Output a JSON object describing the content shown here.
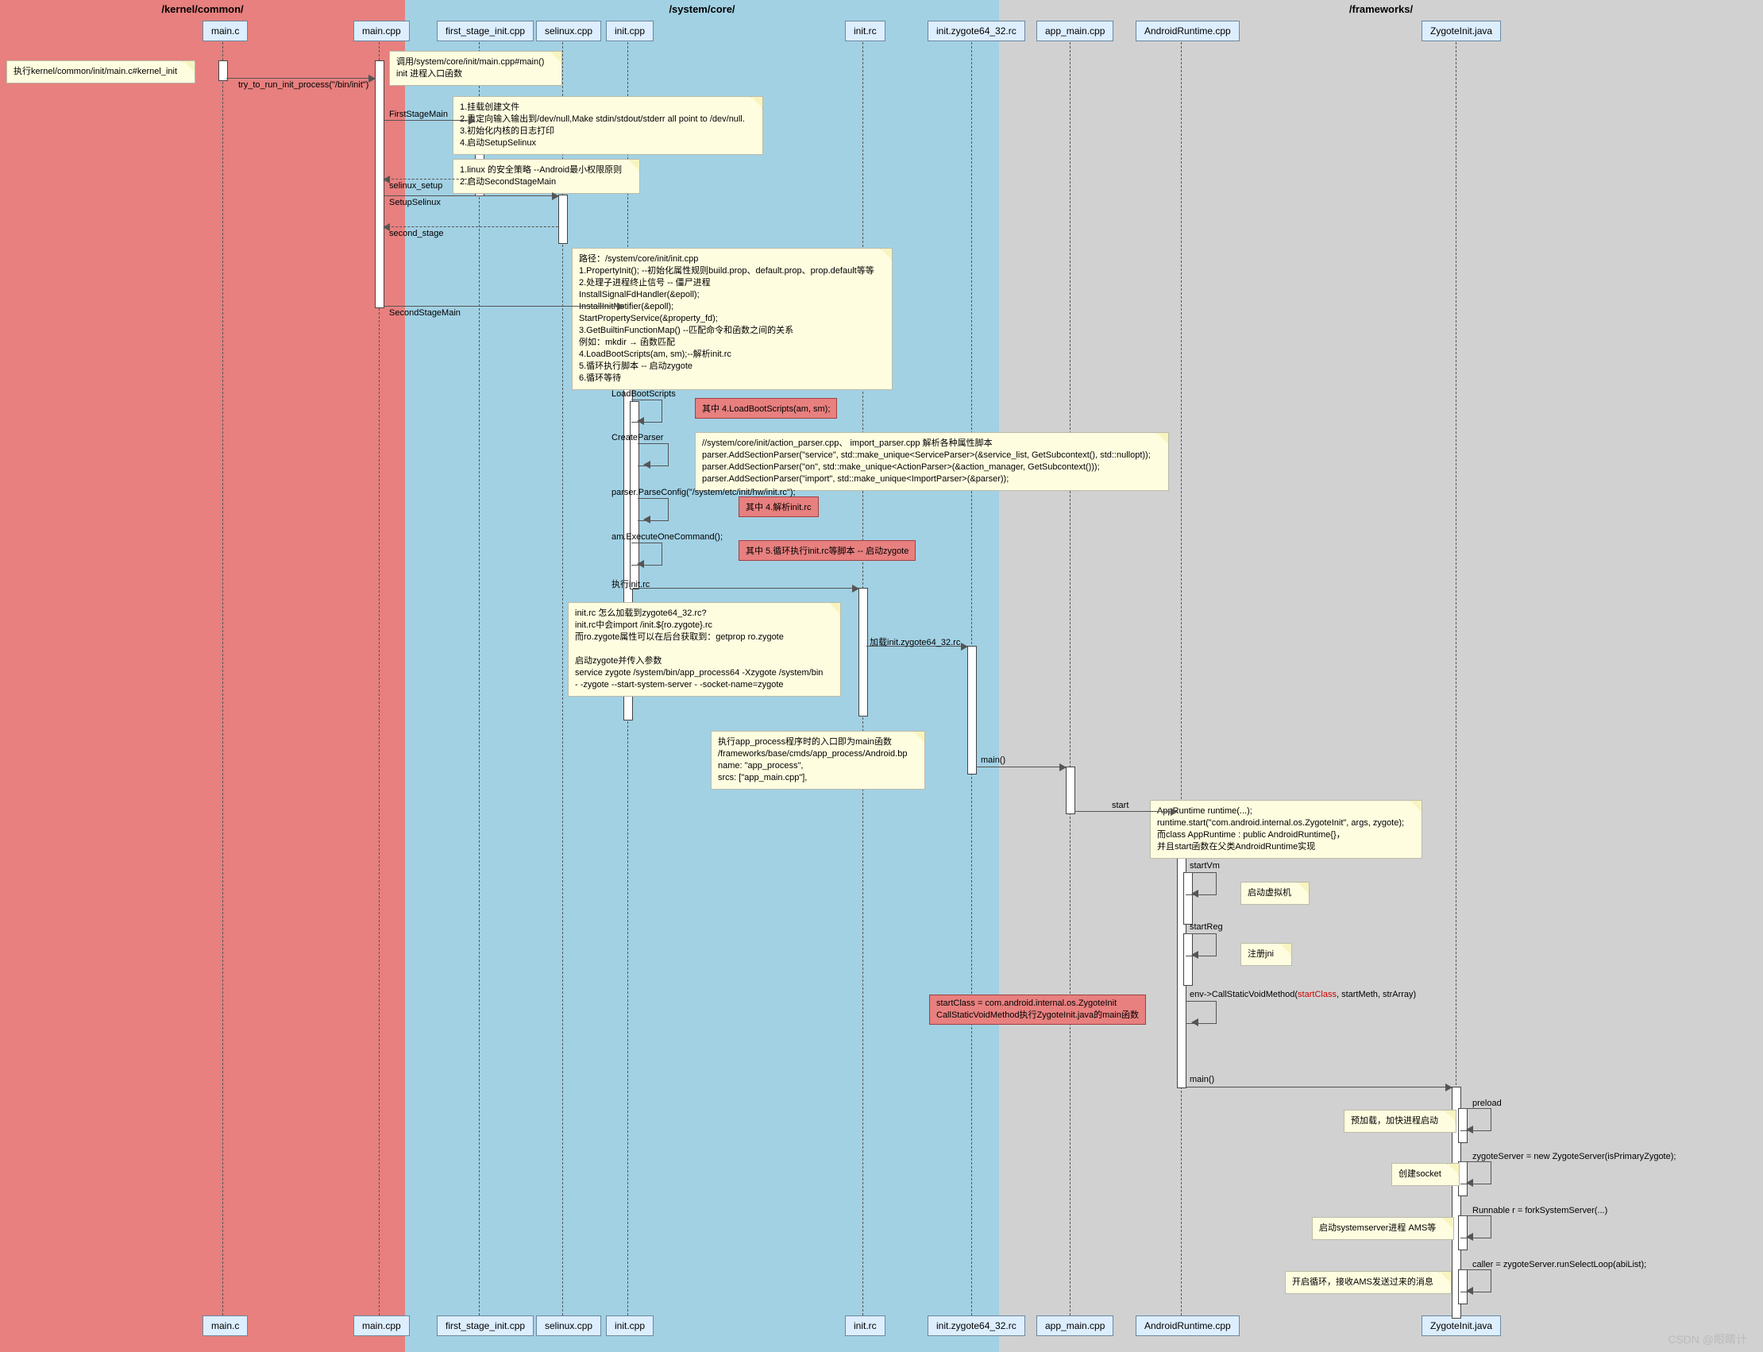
{
  "zones": {
    "kernel": "/kernel/common/",
    "system": "/system/core/",
    "frameworks": "/frameworks/"
  },
  "lifelines": {
    "mainc": "main.c",
    "maincpp": "main.cpp",
    "first_stage": "first_stage_init.cpp",
    "selinuxcpp": "selinux.cpp",
    "initcpp": "init.cpp",
    "initrc": "init.rc",
    "zygote6432": "init.zygote64_32.rc",
    "appmain": "app_main.cpp",
    "androidrt": "AndroidRuntime.cpp",
    "zygoteinit": "ZygoteInit.java"
  },
  "notes": {
    "n_kernel": "执行kernel/common/init/main.c#kernel_init",
    "n_main": "调用/system/core/init/main.cpp#main()\ninit 进程入口函数",
    "n_firststage": "1.挂载创建文件\n2.重定向输入输出到/dev/null,Make stdin/stdout/stderr all point to /dev/null.\n3.初始化内核的日志打印\n4.启动SetupSelinux",
    "n_selinux": "1.linux 的安全策略 --Android最小权限原则\n2.启动SecondStageMain",
    "n_secondstage": "路径：/system/core/init/init.cpp\n1.PropertyInit(); --初始化属性规则build.prop、default.prop、prop.default等等\n2.处理子进程终止信号 -- 僵尸进程\n    InstallSignalFdHandler(&epoll);\n    InstallInitNotifier(&epoll);\n    StartPropertyService(&property_fd);\n3.GetBuiltinFunctionMap() --匹配命令和函数之间的关系\n例如：mkdir → 函数匹配\n4.LoadBootScripts(am, sm);--解析init.rc\n5.循环执行脚本 -- 启动zygote\n6.循环等待",
    "n_parser": "//system/core/init/action_parser.cpp、    import_parser.cpp 解析各种属性脚本\n    parser.AddSectionParser(\"service\", std::make_unique<ServiceParser>(&service_list, GetSubcontext(), std::nullopt));\n    parser.AddSectionParser(\"on\", std::make_unique<ActionParser>(&action_manager, GetSubcontext()));\n    parser.AddSectionParser(\"import\", std::make_unique<ImportParser>(&parser));",
    "n_initrc": "init.rc 怎么加载到zygote64_32.rc?\ninit.rc中会import /init.${ro.zygote}.rc\n而ro.zygote属性可以在后台获取到：getprop ro.zygote\n\n启动zygote并传入参数\nservice zygote /system/bin/app_process64 -Xzygote /system/bin\n- -zygote --start-system-server - -socket-name=zygote",
    "n_appproc": "执行app_process程序时的入口即为main函数\n/frameworks/base/cmds/app_process/Android.bp\nname: \"app_process\",\nsrcs: [\"app_main.cpp\"],",
    "n_appruntime": "AppRuntime runtime(...);\nruntime.start(\"com.android.internal.os.ZygoteInit\", args, zygote);\n而class AppRuntime : public AndroidRuntime{}，\n并且start函数在父类AndroidRuntime实现",
    "n_startvm": "启动虚拟机",
    "n_startreg": "注册jni",
    "n_preload": "预加载，加快进程启动",
    "n_socket": "创建socket",
    "n_fork": "启动systemserver进程 AMS等",
    "n_loop": "开启循环，接收AMS发送过来的消息"
  },
  "callouts": {
    "c_loadboot": "其中 4.LoadBootScripts(am, sm);",
    "c_parseinit": "其中 4.解析init.rc",
    "c_execcmd": "其中 5.循环执行init.rc等脚本 -- 启动zygote",
    "c_startclass1": "startClass = com.android.internal.os.ZygoteInit",
    "c_startclass2": "CallStaticVoidMethod执行ZygoteInit.java的main函数"
  },
  "msgs": {
    "try_run": "try_to_run_init_process(\"/bin/init\")",
    "firststage": "FirstStageMain",
    "selinux_setup": "selinux_setup",
    "setup_selinux": "SetupSelinux",
    "second_stage": "second_stage",
    "secondstagemain": "SecondStageMain",
    "loadboot": "LoadBootScripts",
    "createparser": "CreateParser",
    "parseconfig": "parser.ParseConfig(\"/system/etc/init/hw/init.rc\");",
    "execonecmd": "am.ExecuteOneCommand();",
    "exec_initrc": "执行init.rc",
    "load_zy6432": "加载init.zygote64_32.rc",
    "main_call": "main()",
    "start": "start",
    "startvm": "startVm",
    "startreg": "startReg",
    "callstatic1": "env->CallStaticVoidMethod(",
    "callstatic_cls": "startClass",
    "callstatic2": ", startMeth, strArray)",
    "main2": "main()",
    "preload": "preload",
    "zysrv": "zygoteServer = new ZygoteServer(isPrimaryZygote);",
    "forksys": "Runnable r = forkSystemServer(...)",
    "selloop": "caller = zygoteServer.runSelectLoop(abiList);"
  },
  "watermark": "CSDN @眼睛计"
}
